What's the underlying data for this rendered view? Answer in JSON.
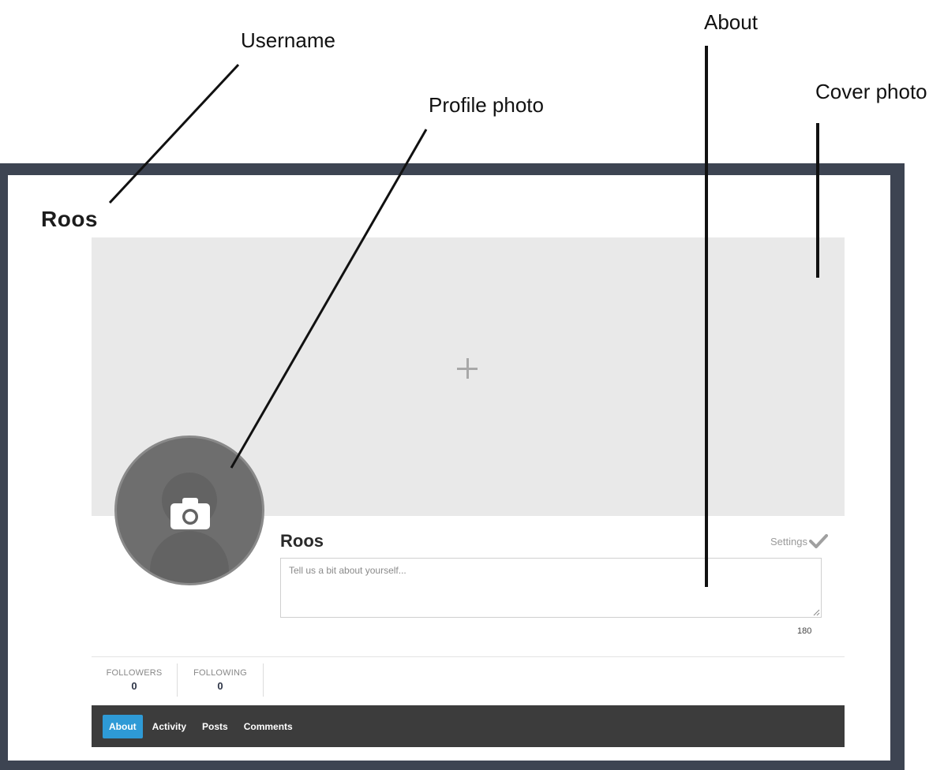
{
  "annotations": {
    "username": "Username",
    "profile_photo": "Profile photo",
    "about": "About",
    "cover_photo": "Cover photo"
  },
  "page": {
    "username_heading": "Roos"
  },
  "profile": {
    "name": "Roos",
    "settings_label": "Settings",
    "about_placeholder": "Tell us a bit about yourself...",
    "about_value": "",
    "char_count": "180"
  },
  "stats": [
    {
      "label": "FOLLOWERS",
      "value": "0"
    },
    {
      "label": "FOLLOWING",
      "value": "0"
    }
  ],
  "tabs": [
    {
      "label": "About",
      "active": true
    },
    {
      "label": "Activity",
      "active": false
    },
    {
      "label": "Posts",
      "active": false
    },
    {
      "label": "Comments",
      "active": false
    }
  ],
  "colors": {
    "frame": "#3d4452",
    "tab_active": "#2e9ad6",
    "tabbar": "#3c3c3c",
    "cover": "#e9e9e9",
    "avatar": "#6e6e6e"
  },
  "icons": {
    "cover_add": "plus-icon",
    "avatar_upload": "camera-icon",
    "settings": "checkmark-icon"
  }
}
